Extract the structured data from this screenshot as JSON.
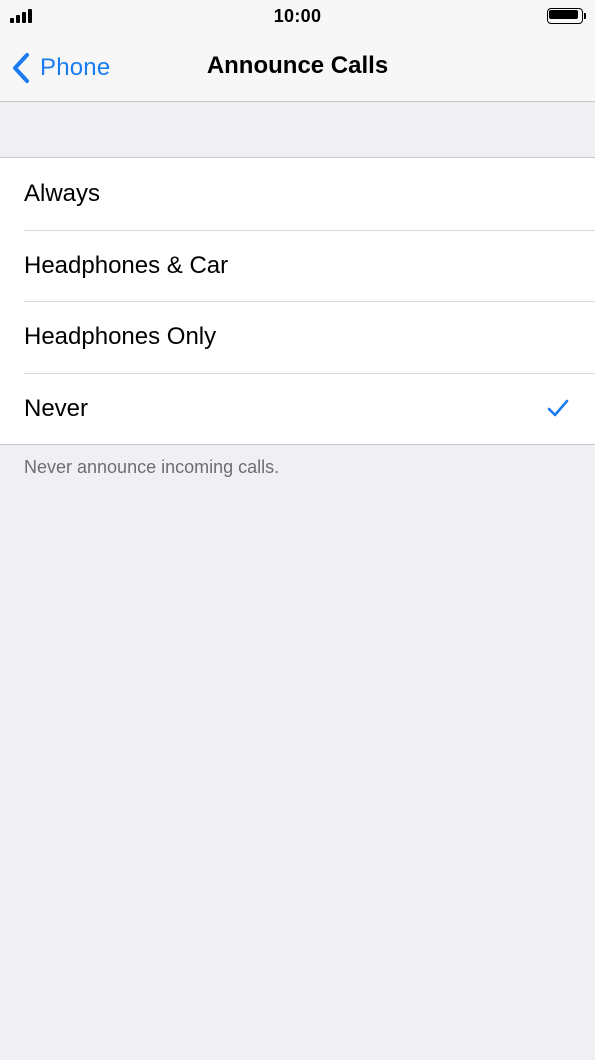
{
  "status_bar": {
    "time": "10:00",
    "signal_icon": "cellular-signal-icon",
    "battery_icon": "battery-icon"
  },
  "nav": {
    "back_label": "Phone",
    "back_icon": "chevron-left-icon",
    "title": "Announce Calls"
  },
  "options": [
    {
      "label": "Always",
      "selected": false
    },
    {
      "label": "Headphones & Car",
      "selected": false
    },
    {
      "label": "Headphones Only",
      "selected": false
    },
    {
      "label": "Never",
      "selected": true
    }
  ],
  "footer_note": "Never announce incoming calls.",
  "colors": {
    "accent": "#1a7cf2",
    "background": "#efeff4",
    "separator": "#c8c7cc",
    "secondary_text": "#6d6d72"
  }
}
